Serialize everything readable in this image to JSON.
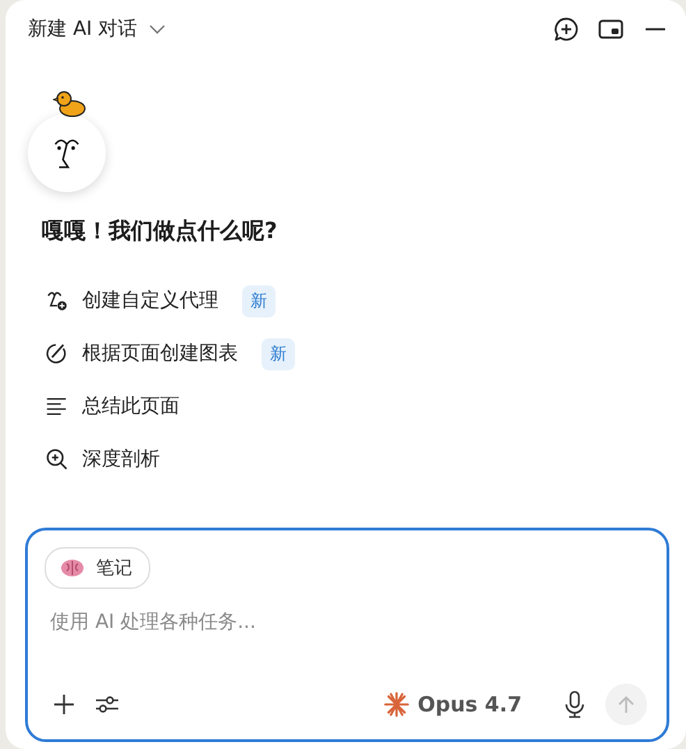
{
  "header": {
    "title": "新建 AI 对话"
  },
  "greeting": "嘎嘎！我们做点什么呢?",
  "actions": [
    {
      "kind": "agent",
      "label": "创建自定义代理",
      "badge": "新"
    },
    {
      "kind": "chart",
      "label": "根据页面创建图表",
      "badge": "新"
    },
    {
      "kind": "summary",
      "label": "总结此页面"
    },
    {
      "kind": "analysis",
      "label": "深度剖析"
    }
  ],
  "composer": {
    "chip": "笔记",
    "placeholder": "使用 AI 处理各种任务...",
    "model": "Opus 4.7"
  }
}
